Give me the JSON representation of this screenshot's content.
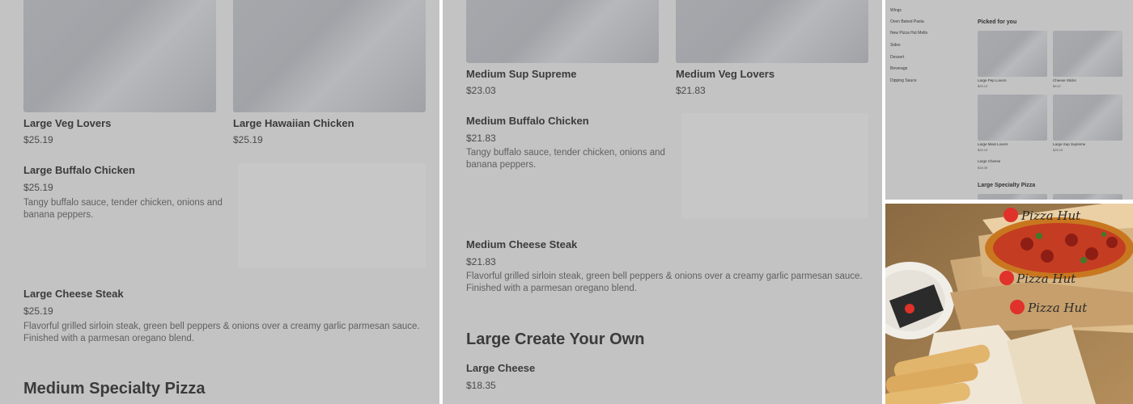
{
  "panel1": {
    "items": [
      {
        "name": "Large Veg Lovers",
        "price": "$25.19"
      },
      {
        "name": "Large Hawaiian Chicken",
        "price": "$25.19"
      },
      {
        "name": "Large Buffalo Chicken",
        "price": "$25.19",
        "desc": "Tangy buffalo sauce, tender chicken, onions and banana peppers."
      },
      {
        "name": "Large Cheese Steak",
        "price": "$25.19",
        "desc": "Flavorful grilled sirloin steak, green bell peppers & onions over a creamy garlic parmesan sauce. Finished with a parmesan oregano blend."
      }
    ],
    "section_heading": "Medium Specialty Pizza"
  },
  "panel2": {
    "items": [
      {
        "name": "Medium Sup Supreme",
        "price": "$23.03"
      },
      {
        "name": "Medium Veg Lovers",
        "price": "$21.83"
      },
      {
        "name": "Medium Buffalo Chicken",
        "price": "$21.83",
        "desc": "Tangy buffalo sauce, tender chicken, onions and banana peppers."
      },
      {
        "name": "Medium Cheese Steak",
        "price": "$21.83",
        "desc": "Flavorful grilled sirloin steak, green bell peppers & onions over a creamy garlic parmesan sauce. Finished with a parmesan oregano blend."
      },
      {
        "name": "Large Cheese",
        "price": "$18.35"
      }
    ],
    "section_heading": "Large Create Your Own"
  },
  "panel3": {
    "nav": [
      "Wings",
      "Oven Baked Pasta",
      "New Pizza Hut Melts",
      "Sides",
      "Dessert",
      "Beverage",
      "Dipping Sauce"
    ],
    "picked_title": "Picked for you",
    "picked": [
      {
        "name": "Large Pep Lovers",
        "price": "$25.19"
      },
      {
        "name": "Cheese Sticks",
        "price": "$9.67"
      },
      {
        "name": "Large Meat Lovers",
        "price": "$25.19"
      },
      {
        "name": "Large Sup Supreme",
        "price": "$25.19"
      },
      {
        "name": "Large Cheese",
        "price": "$18.35"
      }
    ],
    "section_heading": "Large Specialty Pizza"
  },
  "photo": {
    "box_brand": "Pizza Hut",
    "colors": {
      "brand_red": "#e0312b",
      "box": "#d9b887",
      "table": "#a9875a"
    }
  }
}
